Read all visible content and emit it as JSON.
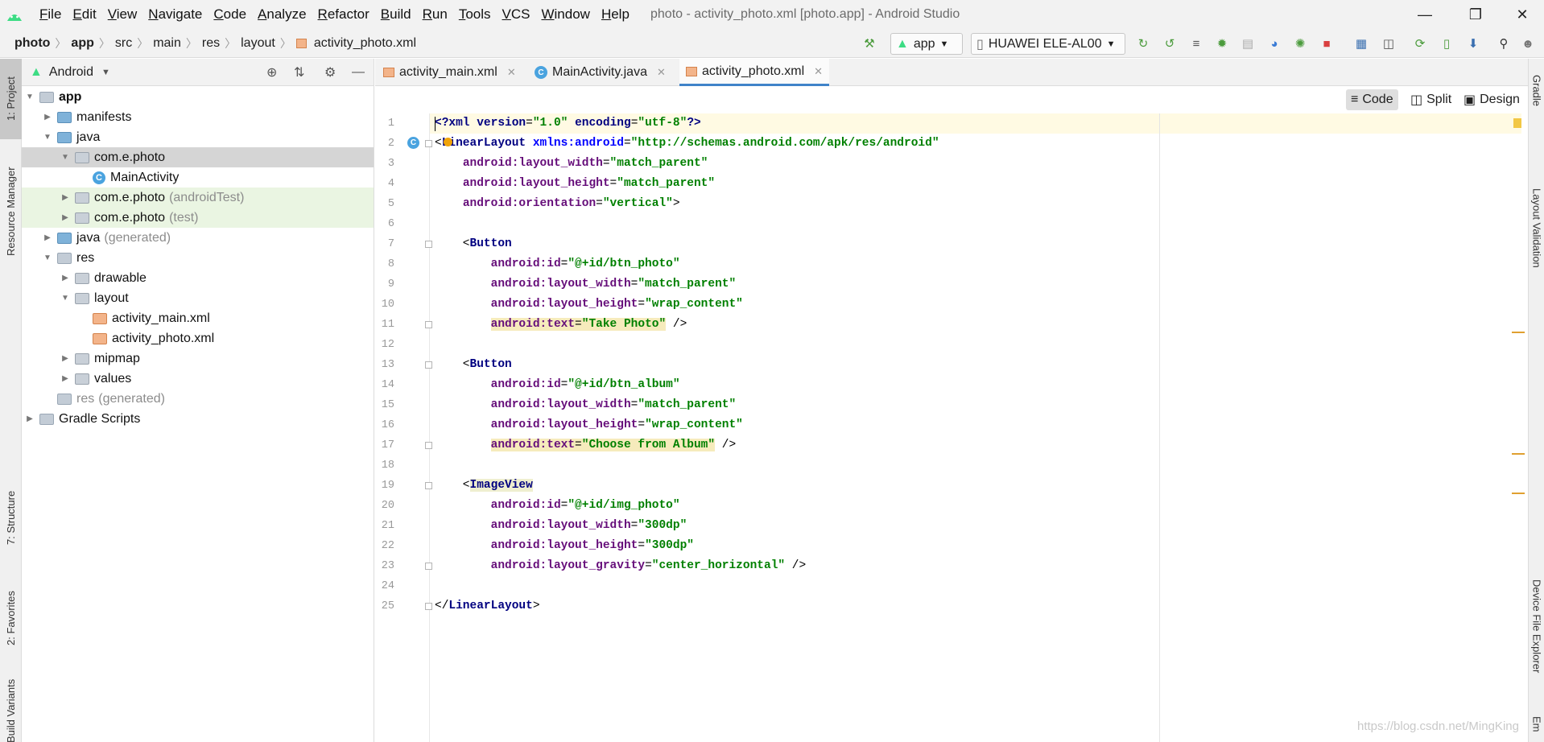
{
  "window": {
    "title": "photo - activity_photo.xml [photo.app] - Android Studio",
    "menu": [
      "File",
      "Edit",
      "View",
      "Navigate",
      "Code",
      "Analyze",
      "Refactor",
      "Build",
      "Run",
      "Tools",
      "VCS",
      "Window",
      "Help"
    ]
  },
  "breadcrumb": [
    "photo",
    "app",
    "src",
    "main",
    "res",
    "layout",
    "activity_photo.xml"
  ],
  "toolbar": {
    "run_config": "app",
    "device": "HUAWEI ELE-AL00"
  },
  "left_strip": {
    "project": "1: Project",
    "resource_manager": "Resource Manager",
    "structure": "7: Structure",
    "favorites": "2: Favorites",
    "build_variants": "Build Variants"
  },
  "right_strip": {
    "gradle": "Gradle",
    "layout_validation": "Layout Validation",
    "device_file_explorer": "Device File Explorer",
    "emulator": "Em"
  },
  "project_panel": {
    "view": "Android",
    "tree": [
      {
        "label": "app",
        "suffix": ""
      },
      {
        "label": "manifests",
        "suffix": ""
      },
      {
        "label": "java",
        "suffix": ""
      },
      {
        "label": "com.e.photo",
        "suffix": ""
      },
      {
        "label": "MainActivity",
        "suffix": ""
      },
      {
        "label": "com.e.photo",
        "suffix": "(androidTest)"
      },
      {
        "label": "com.e.photo",
        "suffix": "(test)"
      },
      {
        "label": "java",
        "suffix": "(generated)"
      },
      {
        "label": "res",
        "suffix": ""
      },
      {
        "label": "drawable",
        "suffix": ""
      },
      {
        "label": "layout",
        "suffix": ""
      },
      {
        "label": "activity_main.xml",
        "suffix": ""
      },
      {
        "label": "activity_photo.xml",
        "suffix": ""
      },
      {
        "label": "mipmap",
        "suffix": ""
      },
      {
        "label": "values",
        "suffix": ""
      },
      {
        "label": "res",
        "suffix": "(generated)"
      },
      {
        "label": "Gradle Scripts",
        "suffix": ""
      }
    ]
  },
  "editor": {
    "tabs": [
      "activity_main.xml",
      "MainActivity.java",
      "activity_photo.xml"
    ],
    "active_tab": "activity_photo.xml",
    "view_modes": [
      "Code",
      "Split",
      "Design"
    ],
    "active_mode": "Code",
    "line_numbers": [
      "1",
      "2",
      "3",
      "4",
      "5",
      "6",
      "7",
      "8",
      "9",
      "10",
      "11",
      "12",
      "13",
      "14",
      "15",
      "16",
      "17",
      "18",
      "19",
      "20",
      "21",
      "22",
      "23",
      "24",
      "25"
    ],
    "lines": [
      "<?xml version=\"1.0\" encoding=\"utf-8\"?>",
      "<LinearLayout xmlns:android=\"http://schemas.android.com/apk/res/android\"",
      "    android:layout_width=\"match_parent\"",
      "    android:layout_height=\"match_parent\"",
      "    android:orientation=\"vertical\">",
      "",
      "    <Button",
      "        android:id=\"@+id/btn_photo\"",
      "        android:layout_width=\"match_parent\"",
      "        android:layout_height=\"wrap_content\"",
      "        android:text=\"Take Photo\" />",
      "",
      "    <Button",
      "        android:id=\"@+id/btn_album\"",
      "        android:layout_width=\"match_parent\"",
      "        android:layout_height=\"wrap_content\"",
      "        android:text=\"Choose from Album\" />",
      "",
      "    <ImageView",
      "        android:id=\"@+id/img_photo\"",
      "        android:layout_width=\"300dp\"",
      "        android:layout_height=\"300dp\"",
      "        android:layout_gravity=\"center_horizontal\" />",
      "",
      "</LinearLayout>"
    ]
  },
  "watermark": "https://blog.csdn.net/MingKing",
  "colors": {
    "accent": "#4083c9",
    "tag": "#000080",
    "attribute": "#660e7a",
    "value": "#008000",
    "highlight": "#f6ebbc"
  }
}
